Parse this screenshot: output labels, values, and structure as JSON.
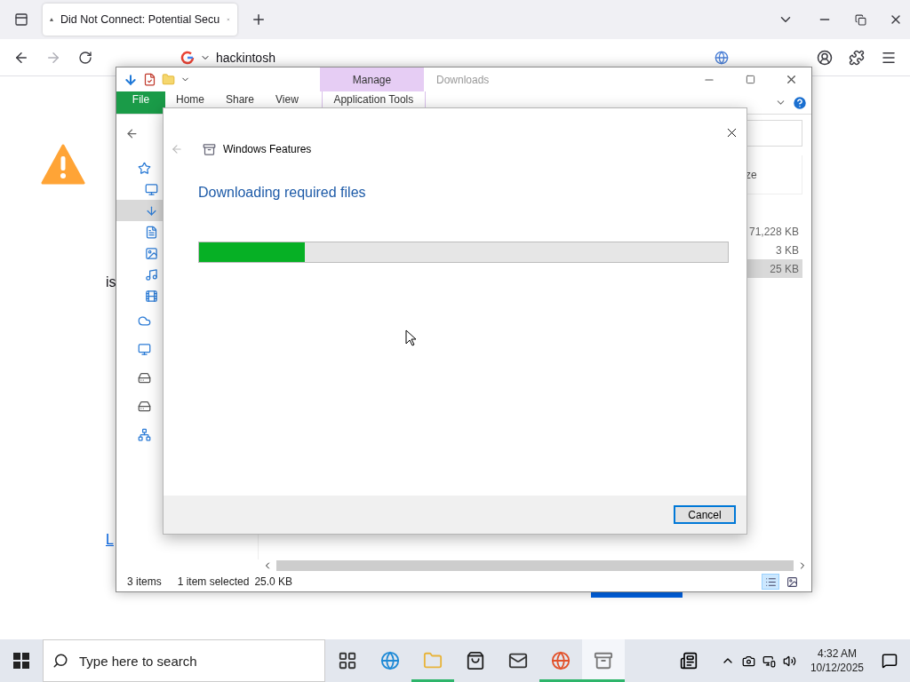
{
  "browser": {
    "tabs": [
      {
        "title": "Did Not Connect: Potential Secu",
        "selected": true
      }
    ],
    "address": "hackintosh",
    "page_fragments": [
      {
        "kind": "text",
        "text": "is"
      },
      {
        "kind": "link",
        "text": "L"
      }
    ]
  },
  "explorer": {
    "title": "Downloads",
    "context_tab": "Manage",
    "ribbon_tabs": [
      {
        "label": "File",
        "kind": "file"
      },
      {
        "label": "Home",
        "kind": "plain"
      },
      {
        "label": "Share",
        "kind": "plain"
      },
      {
        "label": "View",
        "kind": "plain"
      },
      {
        "label": "Application Tools",
        "kind": "context"
      }
    ],
    "nav_items": [
      {
        "kind": "root",
        "selected": false
      },
      {
        "kind": "child",
        "selected": false
      },
      {
        "kind": "child",
        "selected": true
      },
      {
        "kind": "child",
        "selected": false
      },
      {
        "kind": "child",
        "selected": false
      },
      {
        "kind": "child",
        "selected": false
      },
      {
        "kind": "child",
        "selected": false
      },
      {
        "kind": "root",
        "selected": false
      },
      {
        "kind": "root",
        "selected": false
      },
      {
        "kind": "root",
        "selected": false
      },
      {
        "kind": "root",
        "selected": false
      },
      {
        "kind": "root",
        "selected": false
      }
    ],
    "size_header": "ze",
    "rows": [
      {
        "size": "71,228 KB",
        "selected": false
      },
      {
        "size": "3 KB",
        "selected": false
      },
      {
        "size": "25 KB",
        "selected": true
      }
    ],
    "status": {
      "count": "3 items",
      "selection": "1 item selected",
      "size": "25.0 KB"
    }
  },
  "dialog": {
    "title": "Windows Features",
    "heading": "Downloading required files",
    "progress": {
      "level": 0.2
    },
    "button": "Cancel"
  },
  "taskbar": {
    "search_placeholder": "Type here to search",
    "apps": [
      {
        "running": false,
        "selected": false
      },
      {
        "running": false,
        "selected": false
      },
      {
        "running": true,
        "selected": false
      },
      {
        "running": false,
        "selected": false
      },
      {
        "running": false,
        "selected": false
      },
      {
        "running": true,
        "selected": false
      },
      {
        "running": true,
        "selected": true
      }
    ],
    "time": "4:32 AM",
    "date": "10/12/2025"
  }
}
